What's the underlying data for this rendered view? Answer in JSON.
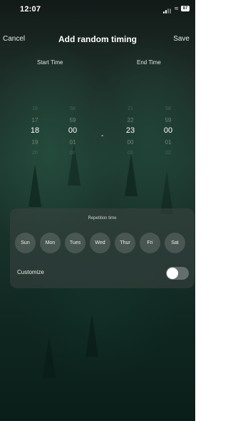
{
  "status_bar": {
    "time": "12:07",
    "battery": "87"
  },
  "nav": {
    "cancel_label": "Cancel",
    "title": "Add random timing",
    "save_label": "Save"
  },
  "pickers": {
    "start_label": "Start Time",
    "end_label": "End Time",
    "start_hour": [
      "16",
      "17",
      "18",
      "19",
      "20"
    ],
    "start_minute": [
      "58",
      "59",
      "00",
      "01",
      "02"
    ],
    "separator": "-",
    "end_hour": [
      "21",
      "22",
      "23",
      "00",
      "01"
    ],
    "end_minute": [
      "58",
      "59",
      "00",
      "01",
      "02"
    ]
  },
  "repetition": {
    "label": "Repetition time",
    "days": [
      "Sun",
      "Mon",
      "Tues",
      "Wed",
      "Thur",
      "Fri",
      "Sat"
    ]
  },
  "customize": {
    "label": "Customize",
    "enabled": false
  }
}
